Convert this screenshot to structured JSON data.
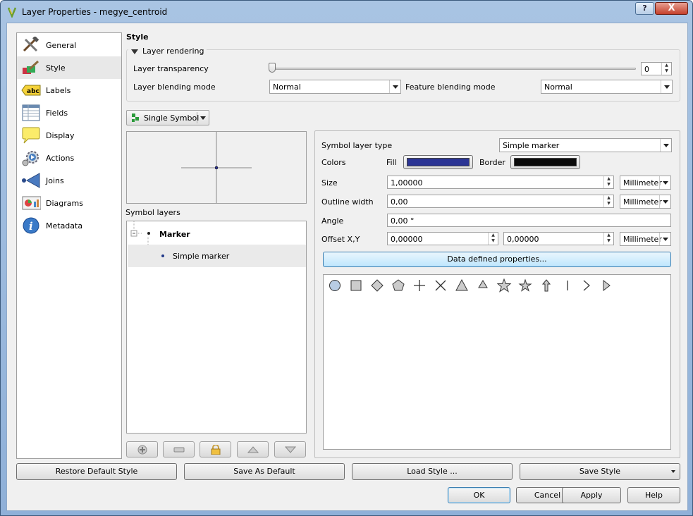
{
  "window": {
    "title": "Layer Properties - megye_centroid"
  },
  "sidebar": {
    "items": [
      {
        "label": "General",
        "icon": "tools-icon",
        "selected": false
      },
      {
        "label": "Style",
        "icon": "brush-icon",
        "selected": true
      },
      {
        "label": "Labels",
        "icon": "abc-label-icon",
        "selected": false
      },
      {
        "label": "Fields",
        "icon": "table-icon",
        "selected": false
      },
      {
        "label": "Display",
        "icon": "speech-bubble-icon",
        "selected": false
      },
      {
        "label": "Actions",
        "icon": "gear-icon",
        "selected": false
      },
      {
        "label": "Joins",
        "icon": "join-icon",
        "selected": false
      },
      {
        "label": "Diagrams",
        "icon": "diagram-icon",
        "selected": false
      },
      {
        "label": "Metadata",
        "icon": "info-icon",
        "selected": false
      }
    ]
  },
  "style": {
    "title": "Style",
    "layer_rendering": {
      "header": "Layer rendering",
      "transparency_label": "Layer transparency",
      "transparency_value": "0",
      "blending_label": "Layer blending mode",
      "blending_value": "Normal",
      "feature_blending_label": "Feature blending mode",
      "feature_blending_value": "Normal"
    },
    "renderer": {
      "label": "Single Symbol"
    },
    "symbol_layers_label": "Symbol layers",
    "tree": {
      "root": "Marker",
      "child": "Simple marker"
    },
    "props": {
      "symbol_layer_type_label": "Symbol layer type",
      "symbol_layer_type_value": "Simple marker",
      "colors_label": "Colors",
      "fill_label": "Fill",
      "border_label": "Border",
      "fill_color": "#2b3494",
      "border_color": "#0a0a0a",
      "size_label": "Size",
      "size_value": "1,00000",
      "size_unit": "Millimeter",
      "outline_label": "Outline width",
      "outline_value": "0,00",
      "outline_unit": "Millimeter",
      "angle_label": "Angle",
      "angle_value": "0,00 °",
      "offset_label": "Offset X,Y",
      "offset_x": "0,00000",
      "offset_y": "0,00000",
      "offset_unit": "Millimeter",
      "data_defined_label": "Data defined properties..."
    },
    "marker_shapes": [
      "circle-icon",
      "square-icon",
      "diamond-icon",
      "pentagon-icon",
      "cross-icon",
      "x-cross-icon",
      "triangle-icon",
      "equilateral-triangle-icon",
      "star-icon",
      "regular-star-icon",
      "arrow-icon",
      "line-icon",
      "arrowhead-icon",
      "filled-arrowhead-icon"
    ]
  },
  "bottom": {
    "restore": "Restore Default Style",
    "save_default": "Save As Default",
    "load": "Load Style ...",
    "save": "Save Style"
  },
  "dialog": {
    "ok": "OK",
    "cancel": "Cancel",
    "apply": "Apply",
    "help": "Help"
  },
  "titlebar": {
    "help": "?",
    "close": "X"
  }
}
